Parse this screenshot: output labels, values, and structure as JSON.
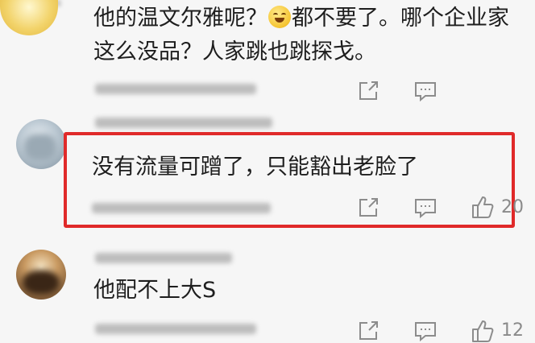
{
  "comments": [
    {
      "line1_before_emoji": "他的温文尔雅呢？",
      "emoji": "grinning-emoji",
      "line1_after_emoji": "都不要了。哪个企业家",
      "line2": "这么没品？人家跳也跳探戈。"
    },
    {
      "text": "没有流量可蹭了，只能豁出老脸了",
      "like_count": "20"
    },
    {
      "text": "他配不上大S",
      "like_count": "12"
    }
  ],
  "icons": {
    "share": "share-icon",
    "reply": "reply-icon",
    "like": "thumbs-up-icon"
  },
  "colors": {
    "highlight_border": "#e02a2a",
    "background": "#f6f6f6",
    "icon": "#8c8c8c"
  }
}
